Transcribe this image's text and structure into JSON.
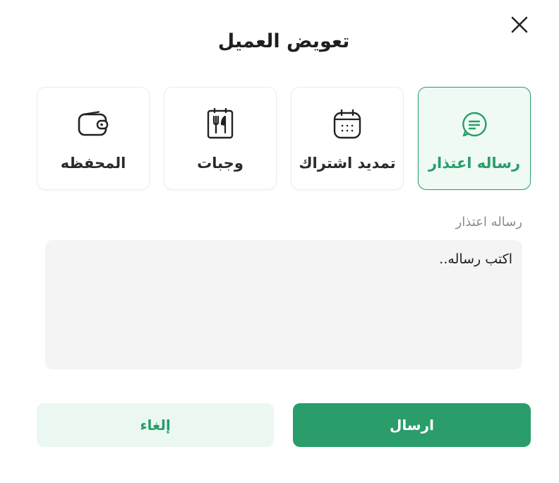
{
  "dialog": {
    "title": "تعويض العميل"
  },
  "options": [
    {
      "label": "رساله اعتذار",
      "icon": "chat-message-icon",
      "selected": true
    },
    {
      "label": "تمديد اشتراك",
      "icon": "calendar-icon",
      "selected": false
    },
    {
      "label": "وجبات",
      "icon": "fork-knife-icon",
      "selected": false
    },
    {
      "label": "المحفظه",
      "icon": "wallet-icon",
      "selected": false
    }
  ],
  "message": {
    "label": "رساله اعتذار",
    "placeholder": "اكتب رساله..",
    "value": ""
  },
  "actions": {
    "send_label": "ارسال",
    "cancel_label": "إلغاء"
  },
  "colors": {
    "accent": "#2a9d6a",
    "accent_light": "#ebf8f2",
    "text": "#1f1f1f",
    "muted": "#8a8a8a",
    "field_bg": "#f4f4f4"
  }
}
